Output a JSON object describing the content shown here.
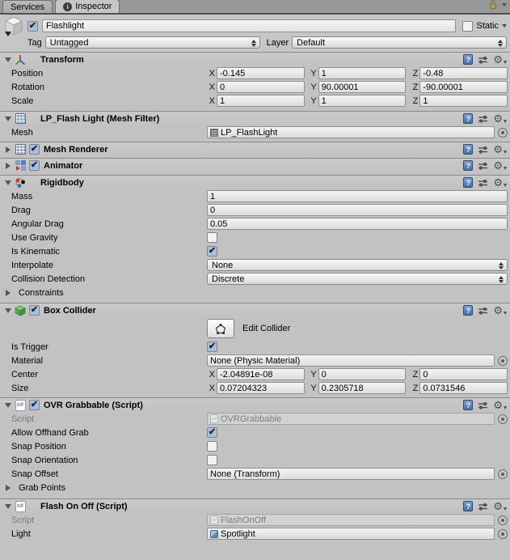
{
  "tabs": {
    "services": "Services",
    "inspector": "Inspector"
  },
  "header": {
    "name": "Flashlight",
    "static_label": "Static",
    "tag_label": "Tag",
    "tag_value": "Untagged",
    "layer_label": "Layer",
    "layer_value": "Default"
  },
  "axes": {
    "x": "X",
    "y": "Y",
    "z": "Z"
  },
  "transform": {
    "title": "Transform",
    "position": {
      "label": "Position",
      "x": "-0.145",
      "y": "1",
      "z": "-0.48"
    },
    "rotation": {
      "label": "Rotation",
      "x": "0",
      "y": "90.00001",
      "z": "-90.00001"
    },
    "scale": {
      "label": "Scale",
      "x": "1",
      "y": "1",
      "z": "1"
    }
  },
  "mesh_filter": {
    "title": "LP_Flash Light (Mesh Filter)",
    "mesh_label": "Mesh",
    "mesh_value": "LP_FlashLight"
  },
  "mesh_renderer": {
    "title": "Mesh Renderer"
  },
  "animator": {
    "title": "Animator"
  },
  "rigidbody": {
    "title": "Rigidbody",
    "mass_label": "Mass",
    "mass": "1",
    "drag_label": "Drag",
    "drag": "0",
    "angular_drag_label": "Angular Drag",
    "angular_drag": "0.05",
    "use_gravity_label": "Use Gravity",
    "is_kinematic_label": "Is Kinematic",
    "interpolate_label": "Interpolate",
    "interpolate": "None",
    "collision_label": "Collision Detection",
    "collision": "Discrete",
    "constraints_label": "Constraints"
  },
  "box_collider": {
    "title": "Box Collider",
    "edit_collider_label": "Edit Collider",
    "is_trigger_label": "Is Trigger",
    "material_label": "Material",
    "material": "None (Physic Material)",
    "center": {
      "label": "Center",
      "x": "-2.04891e-08",
      "y": "0",
      "z": "0"
    },
    "size": {
      "label": "Size",
      "x": "0.07204323",
      "y": "0.2305718",
      "z": "0.0731546"
    }
  },
  "ovr_grabbable": {
    "title": "OVR Grabbable (Script)",
    "script_label": "Script",
    "script": "OVRGrabbable",
    "allow_offhand_label": "Allow Offhand Grab",
    "snap_position_label": "Snap Position",
    "snap_orientation_label": "Snap Orientation",
    "snap_offset_label": "Snap Offset",
    "snap_offset": "None (Transform)",
    "grab_points_label": "Grab Points"
  },
  "flash_on_off": {
    "title": "Flash On Off (Script)",
    "script_label": "Script",
    "script": "FlashOnOff",
    "light_label": "Light",
    "light": "Spotlight"
  },
  "colors": {
    "checkbox_checked_bg": "#a5c0dc",
    "check_mark": "#14243a",
    "collider_green": "#46a546",
    "script_blue": "#4f7cbf",
    "help_book_blue": "#4a6ea5"
  }
}
